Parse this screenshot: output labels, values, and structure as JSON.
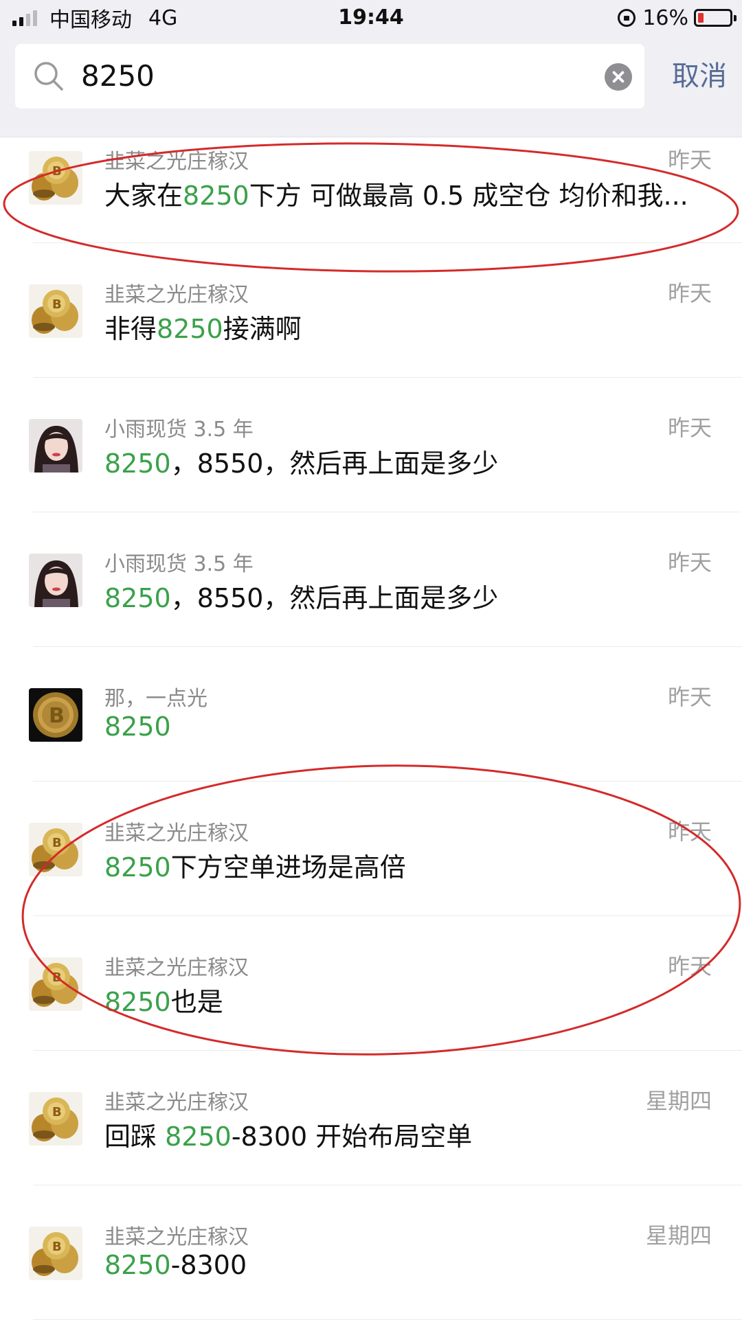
{
  "status_bar": {
    "carrier": "中国移动",
    "network": "4G",
    "time": "19:44",
    "battery": "16%",
    "battery_color": "#e0312c"
  },
  "search": {
    "query": "8250",
    "cancel_label": "取消",
    "icons": [
      "search-icon",
      "clear-icon"
    ]
  },
  "colors": {
    "highlight": "#3aa14a",
    "cancel": "#566b95",
    "annotation": "#d42a2a"
  },
  "results": [
    {
      "avatar": "coins",
      "sender": "韭菜之光庄稼汉",
      "date": "昨天",
      "before": "大家在",
      "match": "8250",
      "after": "下方 可做最高 0.5 成空仓 均价和我..."
    },
    {
      "avatar": "coins",
      "sender": "韭菜之光庄稼汉",
      "date": "昨天",
      "before": "非得",
      "match": "8250",
      "after": "接满啊"
    },
    {
      "avatar": "woman",
      "sender": "小雨现货 3.5 年",
      "date": "昨天",
      "before": "",
      "match": "8250",
      "after": "，8550，然后再上面是多少"
    },
    {
      "avatar": "woman",
      "sender": "小雨现货 3.5 年",
      "date": "昨天",
      "before": "",
      "match": "8250",
      "after": "，8550，然后再上面是多少"
    },
    {
      "avatar": "bitcoin",
      "sender": "那，一点光",
      "date": "昨天",
      "before": "",
      "match": "8250",
      "after": ""
    },
    {
      "avatar": "coins",
      "sender": "韭菜之光庄稼汉",
      "date": "昨天",
      "before": "",
      "match": "8250",
      "after": "下方空单进场是高倍"
    },
    {
      "avatar": "coins",
      "sender": "韭菜之光庄稼汉",
      "date": "昨天",
      "before": "",
      "match": "8250",
      "after": "也是"
    },
    {
      "avatar": "coins",
      "sender": "韭菜之光庄稼汉",
      "date": "星期四",
      "before": "回踩 ",
      "match": "8250",
      "after": "-8300 开始布局空单"
    },
    {
      "avatar": "coins",
      "sender": "韭菜之光庄稼汉",
      "date": "星期四",
      "before": "",
      "match": "8250",
      "after": "-8300"
    }
  ]
}
